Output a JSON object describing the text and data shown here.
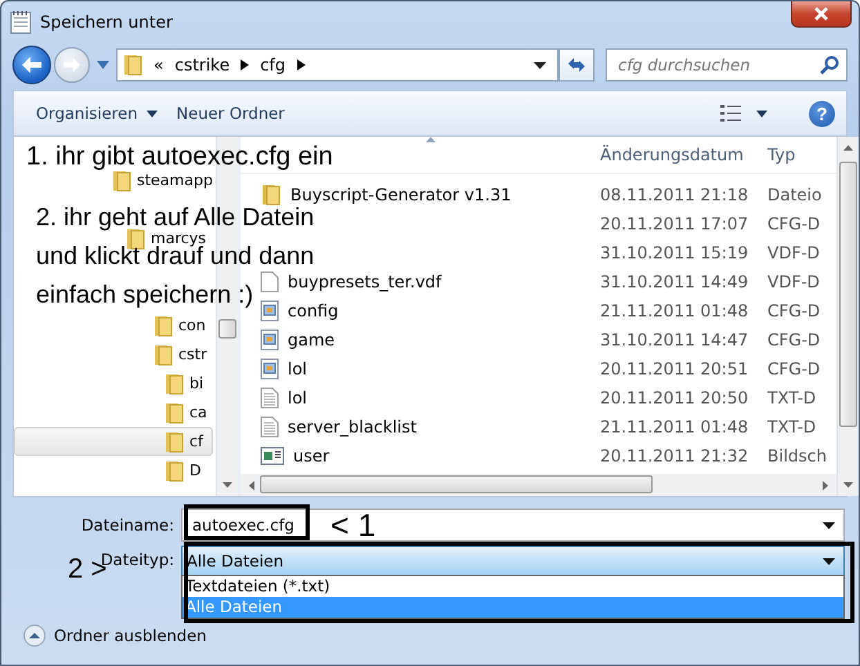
{
  "window": {
    "title": "Speichern unter"
  },
  "address": {
    "overflow": "«",
    "path": [
      "cstrike",
      "cfg"
    ],
    "search_placeholder": "cfg durchsuchen"
  },
  "toolbar": {
    "organize": "Organisieren",
    "new_folder": "Neuer Ordner",
    "help": "?"
  },
  "tree": [
    {
      "label": "steamapp",
      "selected": false,
      "children": [
        {
          "label": "marcys",
          "selected": false,
          "children": [
            {
              "label": "con",
              "selected": false
            },
            {
              "label": "cstr",
              "selected": false,
              "children": [
                {
                  "label": "bi",
                  "selected": false
                },
                {
                  "label": "ca",
                  "selected": false
                },
                {
                  "label": "cf",
                  "selected": true
                },
                {
                  "label": "D",
                  "selected": false
                }
              ]
            }
          ]
        }
      ]
    }
  ],
  "files": {
    "columns": [
      "Änderungsdatum",
      "Typ"
    ],
    "rows": [
      {
        "kind": "folder",
        "name": "Buyscript-Generator v1.31",
        "date": "08.11.2011 21:18",
        "type": "Dateio"
      },
      {
        "date": "20.11.2011 17:07",
        "type": "CFG-D"
      },
      {
        "date": "31.10.2011 15:19",
        "type": "VDF-D"
      },
      {
        "kind": "blank",
        "name": "buypresets_ter.vdf",
        "date": "31.10.2011 14:49",
        "type": "VDF-D"
      },
      {
        "kind": "cfg",
        "name": "config",
        "date": "21.11.2011 01:48",
        "type": "CFG-D"
      },
      {
        "kind": "cfg",
        "name": "game",
        "date": "31.10.2011 14:47",
        "type": "CFG-D"
      },
      {
        "kind": "cfg",
        "name": "lol",
        "date": "20.11.2011 20:51",
        "type": "CFG-D"
      },
      {
        "kind": "text",
        "name": "lol",
        "date": "20.11.2011 20:50",
        "type": "TXT-D"
      },
      {
        "kind": "text",
        "name": "server_blacklist",
        "date": "21.11.2011 01:48",
        "type": "TXT-D"
      },
      {
        "kind": "image",
        "name": "user",
        "date": "20.11.2011 21:32",
        "type": "Bildsch"
      }
    ]
  },
  "form": {
    "filename_label": "Dateiname:",
    "filename": "autoexec.cfg",
    "filetype_label": "Dateityp:",
    "filetype": "Alle Dateien",
    "filetype_options": [
      {
        "label": "Textdateien (*.txt)",
        "selected": false
      },
      {
        "label": "Alle Dateien",
        "selected": true
      }
    ],
    "hide_folders": "Ordner ausblenden"
  },
  "annotations": {
    "step_1": "1. ihr gibt autoexec.cfg ein",
    "step_2": [
      "2. ihr geht auf Alle Datein",
      "und klickt drauf und dann",
      "einfach speichern :)"
    ],
    "marker_1": "< 1",
    "marker_2": "2  >"
  }
}
